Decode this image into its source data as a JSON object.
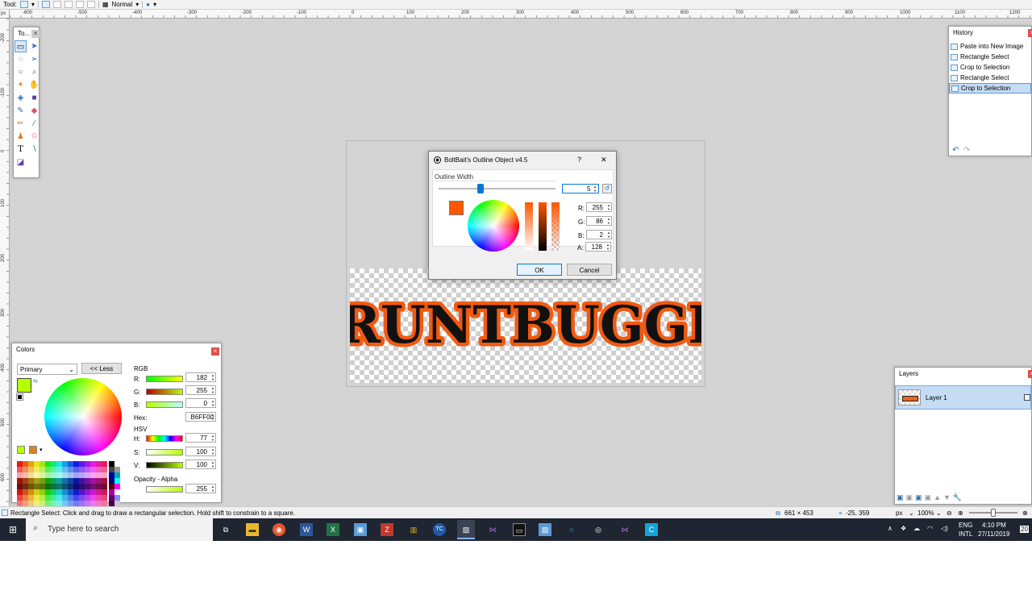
{
  "toolbar": {
    "tool_label": "Tool:",
    "blend_mode": "Normal"
  },
  "rulers": {
    "unit": "px",
    "top_ticks": [
      "-600",
      "-500",
      "-400",
      "-300",
      "-200",
      "-100",
      "0",
      "100",
      "200",
      "300",
      "400",
      "500",
      "600",
      "700",
      "800",
      "900",
      "1000",
      "1100",
      "1200"
    ],
    "left_ticks": [
      "-200",
      "-100",
      "0",
      "100",
      "200",
      "300",
      "400",
      "500",
      "600"
    ]
  },
  "tools_window": {
    "title": "To..."
  },
  "history": {
    "title": "History",
    "items": [
      {
        "label": "Paste into New Image"
      },
      {
        "label": "Rectangle Select"
      },
      {
        "label": "Crop to Selection"
      },
      {
        "label": "Rectangle Select"
      },
      {
        "label": "Crop to Selection"
      }
    ],
    "selected_index": 4
  },
  "layers": {
    "title": "Layers",
    "layer_name": "Layer 1"
  },
  "canvas": {
    "artwork_text": "GRUNTBUGGLY",
    "text_color": "#111111",
    "outline_color": "#f05a12"
  },
  "colors": {
    "title": "Colors",
    "mode": "Primary",
    "less_button": "<< Less",
    "rgb_label": "RGB",
    "r_label": "R:",
    "r_value": "182",
    "g_label": "G:",
    "g_value": "255",
    "b_label": "B:",
    "b_value": "0",
    "hex_label": "Hex:",
    "hex_value": "B6FF00",
    "hsv_label": "HSV",
    "h_label": "H:",
    "h_value": "77",
    "s_label": "S:",
    "s_value": "100",
    "v_label": "V:",
    "v_value": "100",
    "opacity_label": "Opacity - Alpha",
    "alpha_value": "255",
    "primary_color": "#b6ff00",
    "secondary_color": "#ffffff"
  },
  "dialog": {
    "title": "BoltBait's Outline Object v4.5",
    "help": "?",
    "close": "✕",
    "outline_width_label": "Outline Width",
    "outline_width_value": "5",
    "r_label": "R:",
    "r_value": "255",
    "g_label": "G:",
    "g_value": "86",
    "b_label": "B:",
    "b_value": "2",
    "a_label": "A:",
    "a_value": "128",
    "ok": "OK",
    "cancel": "Cancel",
    "swatch_color": "#ff5602"
  },
  "statusbar": {
    "hint": "Rectangle Select: Click and drag to draw a rectangular selection. Hold shift to constrain to a square.",
    "size": "661 × 453",
    "cursor": "-25, 359",
    "unit": "px",
    "zoom": "100%"
  },
  "taskbar": {
    "search_placeholder": "Type here to search",
    "language": "ENG",
    "layout": "INTL",
    "time": "4:10 PM",
    "date": "27/11/2019",
    "notification_count": "20"
  }
}
